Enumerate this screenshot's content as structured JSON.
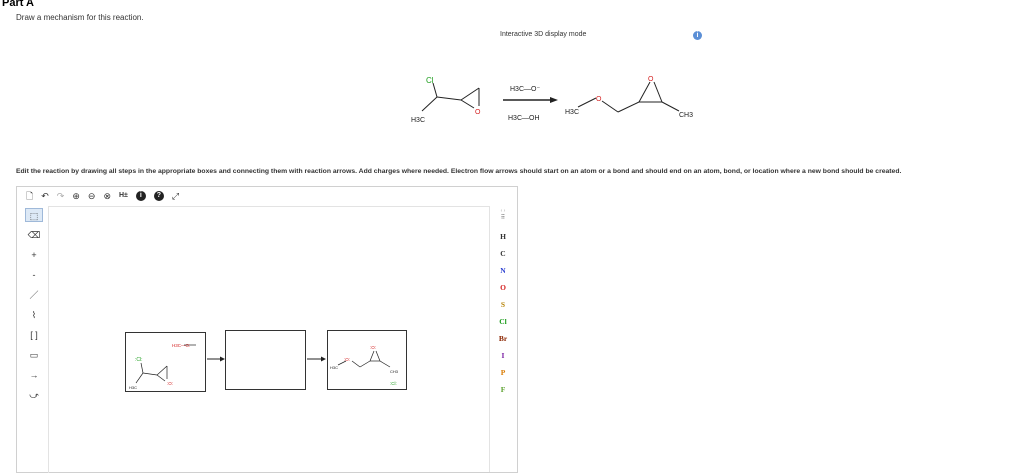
{
  "part": {
    "title": "Part A",
    "prompt": "Draw a mechanism for this reaction."
  },
  "display_mode": {
    "label": "Interactive 3D display mode",
    "info_icon": "info-icon"
  },
  "scheme": {
    "reactant": {
      "substituent": "Cl",
      "methyl": "H3C",
      "epoxide_o": "O"
    },
    "reagents": {
      "above": "H3C—O⁻",
      "below": "H3C—OH"
    },
    "product": {
      "methoxy": "H3C",
      "ether_o": "O",
      "epoxide_o": "O",
      "methyl": "CH3"
    }
  },
  "instructions": "Edit the reaction by drawing all steps in the appropriate boxes and connecting them with reaction arrows. Add charges where needed. Electron flow arrows should start on an atom or a bond and should end on an atom, bond, or location where a new bond should be created.",
  "toolbar": {
    "new": "🗋",
    "undo": "↶",
    "redo": "↷",
    "zoom_in": "⊕",
    "zoom_out": "⊖",
    "zoom_fit": "⊗",
    "h_toggle": "H±",
    "info": "i",
    "help": "?",
    "fullscreen": "⤢"
  },
  "left_tools": [
    "⬚",
    "⌫",
    "+",
    "-",
    "／",
    "⌇",
    "[ ]",
    "▭",
    "→",
    "⤻"
  ],
  "periodic": {
    "nav": "‹ ›",
    "grid": "⠿",
    "elements": [
      {
        "symbol": "H",
        "color": "#333333"
      },
      {
        "symbol": "C",
        "color": "#333333"
      },
      {
        "symbol": "N",
        "color": "#2b3fd1"
      },
      {
        "symbol": "O",
        "color": "#d42020"
      },
      {
        "symbol": "S",
        "color": "#b8860b"
      },
      {
        "symbol": "Cl",
        "color": "#1a9c1a"
      },
      {
        "symbol": "Br",
        "color": "#8b2500"
      },
      {
        "symbol": "I",
        "color": "#7a1fa2"
      },
      {
        "symbol": "P",
        "color": "#d97a00"
      },
      {
        "symbol": "F",
        "color": "#5aa02c"
      }
    ]
  },
  "canvas_boxes": {
    "box1": {
      "cl": ":Cl:",
      "methyl": "H3C",
      "o": ":O:",
      "reagent": "H3C—O:"
    },
    "box3": {
      "ether_o": ":O:",
      "methoxy": "H3C",
      "epoxide_o": ":O:",
      "methyl": "CH3",
      "chloride": ":Cl:"
    }
  }
}
